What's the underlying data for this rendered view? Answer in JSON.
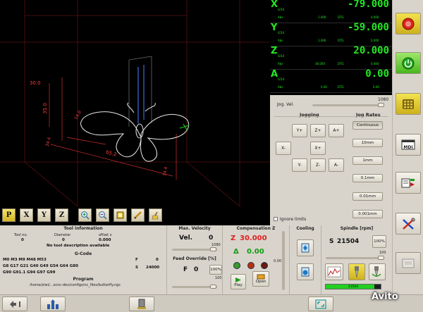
{
  "viewport": {
    "dimensions": [
      "30.0",
      "35.0",
      "34.4",
      "65.2",
      "14.0",
      "34.4"
    ],
    "toolbar_buttons": [
      "P",
      "X",
      "Y",
      "Z"
    ]
  },
  "dro": {
    "units_label": "G54",
    "axes": [
      {
        "letter": "X",
        "value": "-79.000",
        "abs_label": "Abs",
        "abs": "1.000",
        "dtg_label": "DTG",
        "dtg": "0.000"
      },
      {
        "letter": "Y",
        "value": "-59.000",
        "abs_label": "Abs",
        "abs": "1.000",
        "dtg_label": "DTG",
        "dtg": "0.000"
      },
      {
        "letter": "Z",
        "value": "20.000",
        "abs_label": "Abs",
        "abs": "30.000",
        "dtg_label": "DTG",
        "dtg": "0.000"
      },
      {
        "letter": "A",
        "value": "0.00",
        "abs_label": "Abs",
        "abs": "0.00",
        "dtg_label": "DTG",
        "dtg": "0.00"
      }
    ]
  },
  "jog": {
    "vel_label": "Jog. Vel.",
    "vel_value": "1080",
    "jogging_title": "Jogging",
    "rates_title": "Jog Rates",
    "buttons": {
      "yplus": "Y+",
      "zplus": "Z+",
      "aplus": "A+",
      "xminus": "X-",
      "xplus": "X+",
      "yminus": "Y-",
      "zminus": "Z-",
      "aminus": "A-"
    },
    "rates": [
      "Continuous",
      "10mm",
      "1mm",
      "0.1mm",
      "0.01mm",
      "0.001mm"
    ],
    "ignore_limits": "Ignore limits"
  },
  "tool": {
    "title": "Tool information",
    "toolno_label": "Tool no.",
    "toolno": "0",
    "diameter_label": "Diameter",
    "diameter": "0",
    "offset_label": "offset z",
    "offset": "0.000",
    "description": "No tool description available"
  },
  "gcode": {
    "title": "G-Code",
    "line1": "M0 M3 M9 M48 M53",
    "line2": "G8 G17 G21 G40 G49 G54 G64 G80",
    "line3": "G90 G91.1 G94 G97 G99",
    "f_label": "F",
    "f_value": "0",
    "s_label": "S",
    "s_value": "24000"
  },
  "program": {
    "title": "Program",
    "path": "/home/ziwi/...xcnc-dev/configs/nc_files/butterfly.ngc"
  },
  "maxvel": {
    "title": "Max. Velocity",
    "label": "Vel.",
    "value": "0",
    "max": "1080"
  },
  "feed": {
    "title": "Feed Override [%]",
    "label": "F",
    "value": "0",
    "pct": "100%",
    "scale_max": "100"
  },
  "comp": {
    "title": "Compensation Z",
    "z_label": "Z",
    "z_value": "30.000",
    "delta_label": "Δ",
    "delta_value": "0.00",
    "side_value": "0.00",
    "play_label": "Play",
    "open_label": "Open"
  },
  "cooling": {
    "title": "Cooling"
  },
  "spindle": {
    "title": "Spindle [rpm]",
    "label": "S",
    "value": "21504",
    "pct": "100%",
    "scale_max": "100",
    "bar_text": "21504"
  },
  "colors": {
    "dro_green": "#22e822",
    "dimension_red": "#ff3a3a",
    "estop_red": "#d9241a"
  },
  "watermark": "Avito"
}
